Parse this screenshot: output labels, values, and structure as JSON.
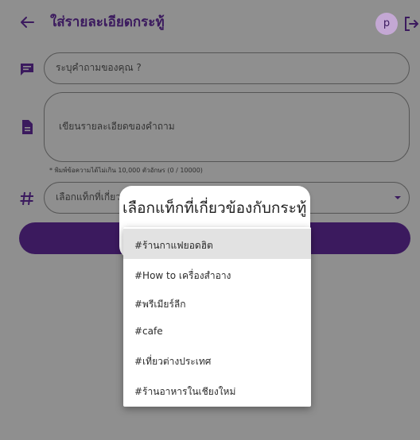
{
  "header": {
    "title": "ใส่รายละเอียดกระทู้",
    "avatar_initial": "p"
  },
  "form": {
    "question_placeholder": "ระบุคำถามของคุณ ?",
    "detail_placeholder": "เขียนรายละเอียดของคำถาม",
    "char_hint": "* พิมพ์ข้อความได้ไม่เกิน 10,000 ตัวอักษร (0 / 10000)",
    "tag_placeholder": "เลือกแท็กที่เกี่ยวข้องกับกระทู้"
  },
  "popup": {
    "title": "เลือกแท็กที่เกี่ยวข้องกับกระทู้",
    "options": [
      "#ร้านกาแฟยอดฮิต",
      "#How to เครื่องสำอาง",
      "#พรีเมียร์ลีก",
      "#cafe",
      "#เที่ยวต่างประเทศ",
      "#ร้านอาหารในเชียงใหม่"
    ]
  },
  "colors": {
    "brand": "#3b1a5e",
    "avatar_bg": "#c4a8d4",
    "overlay": "#8f8f8f"
  },
  "icons": {
    "back": "arrow-left-icon",
    "logout": "logout-icon",
    "question": "chat-bubble-icon",
    "detail": "document-icon",
    "tag": "hashtag-icon",
    "dropdown": "caret-down-icon"
  }
}
